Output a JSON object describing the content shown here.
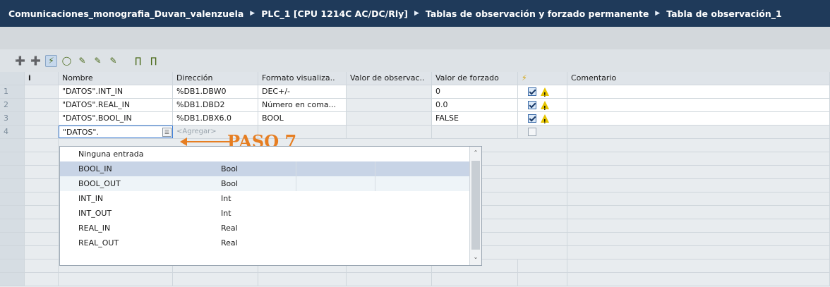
{
  "breadcrumb": [
    "Comunicaciones_monografia_Duvan_valenzuela",
    "PLC_1 [CPU 1214C AC/DC/Rly]",
    "Tablas de observación y forzado permanente",
    "Tabla de observación_1"
  ],
  "columns": {
    "info": "i",
    "nombre": "Nombre",
    "direccion": "Dirección",
    "formato": "Formato visualiza..",
    "valor_obs": "Valor de observac..",
    "valor_forz": "Valor de forzado",
    "force_icon": "lightning-icon",
    "comentario": "Comentario"
  },
  "rows": [
    {
      "num": "1",
      "nombre": "\"DATOS\".INT_IN",
      "direccion": "%DB1.DBW0",
      "formato": "DEC+/-",
      "forz": "0",
      "checked": true,
      "warning": true
    },
    {
      "num": "2",
      "nombre": "\"DATOS\".REAL_IN",
      "direccion": "%DB1.DBD2",
      "formato": "Número en coma...",
      "forz": "0.0",
      "checked": true,
      "warning": true
    },
    {
      "num": "3",
      "nombre": "\"DATOS\".BOOL_IN",
      "direccion": "%DB1.DBX6.0",
      "formato": "BOOL",
      "forz": "FALSE",
      "checked": true,
      "warning": true
    }
  ],
  "edit_row": {
    "num": "4",
    "value": "\"DATOS\".",
    "placeholder": "<Agregar>"
  },
  "annotation": "PASO 7",
  "dropdown": {
    "items": [
      {
        "name": "Ninguna entrada",
        "type": ""
      },
      {
        "name": "BOOL_IN",
        "type": "Bool"
      },
      {
        "name": "BOOL_OUT",
        "type": "Bool"
      },
      {
        "name": "INT_IN",
        "type": "Int"
      },
      {
        "name": "INT_OUT",
        "type": "Int"
      },
      {
        "name": "REAL_IN",
        "type": "Real"
      },
      {
        "name": "REAL_OUT",
        "type": "Real"
      }
    ]
  },
  "colors": {
    "header_bg": "#1f3a5a",
    "annotation": "#e67e22",
    "selected_row": "#c8d4e6"
  }
}
